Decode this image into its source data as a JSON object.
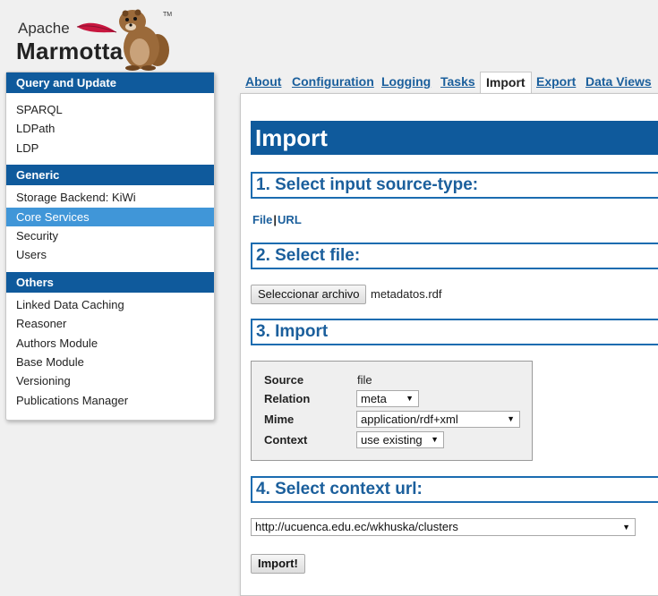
{
  "logo": {
    "line1": "Apache",
    "line2": "Marmotta",
    "tm": "TM"
  },
  "sidebar": {
    "sections": [
      {
        "title": "Query and Update",
        "items": [
          "SPARQL",
          "LDPath",
          "LDP"
        ]
      },
      {
        "title": "Generic",
        "items": [
          "Storage Backend: KiWi",
          "Core Services",
          "Security",
          "Users"
        ]
      },
      {
        "title": "Others",
        "items": [
          "Linked Data Caching",
          "Reasoner",
          "Authors Module",
          "Base Module",
          "Versioning",
          "Publications Manager"
        ]
      }
    ],
    "active_item": "Core Services"
  },
  "tabs": [
    "About",
    "Configuration",
    "Logging",
    "Tasks",
    "Import",
    "Export",
    "Data Views"
  ],
  "active_tab": "Import",
  "main": {
    "title": "Import",
    "step1": "1. Select input source-type:",
    "source_links": {
      "file": "File",
      "sep": "|",
      "url": "URL"
    },
    "step2": "2. Select file:",
    "file_button": "Seleccionar archivo",
    "file_name": "metadatos.rdf",
    "step3": "3. Import",
    "import_settings": {
      "source_label": "Source",
      "source_value": "file",
      "relation_label": "Relation",
      "relation_value": "meta",
      "mime_label": "Mime",
      "mime_value": "application/rdf+xml",
      "context_label": "Context",
      "context_value": "use existing"
    },
    "step4": "4. Select context url:",
    "context_url": "http://ucuenca.edu.ec/wkhuska/clusters",
    "import_button": "Import!"
  },
  "colors": {
    "header_blue": "#0f5a9c",
    "active_blue": "#4096d8",
    "link_blue": "#1b5f9c"
  }
}
